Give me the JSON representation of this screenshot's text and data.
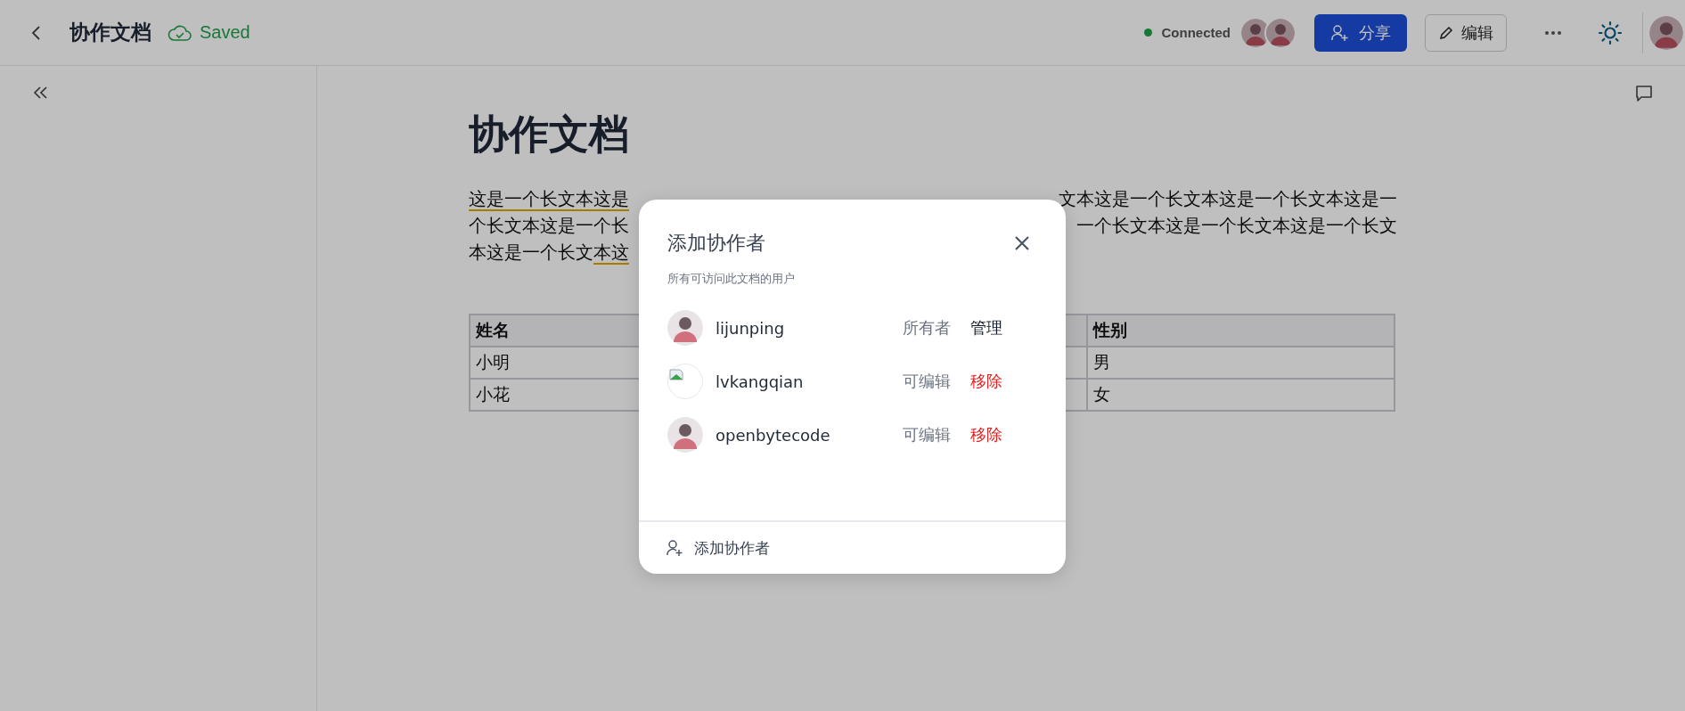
{
  "header": {
    "title": "协作文档",
    "save_status": "Saved",
    "connection": {
      "label": "Connected",
      "connected": true
    },
    "share_button": "分享",
    "edit_button": "编辑"
  },
  "document": {
    "title": "协作文档",
    "lines": [
      {
        "left": [
          {
            "text": "这是一个长文本这是",
            "commented": true
          }
        ],
        "right": [
          {
            "text": "文本这是一个长文本这是一个长文本这是一",
            "commented": false
          }
        ]
      },
      {
        "left": [
          {
            "text": "个长文本这是一个长",
            "commented": false
          }
        ],
        "right": [
          {
            "text": "一个长文本这是一个长文本这是一个长文",
            "commented": false
          }
        ]
      },
      {
        "left": [
          {
            "text": "本这是一个长文",
            "commented": false
          },
          {
            "text": "本这",
            "commented": true
          }
        ]
      }
    ],
    "table": {
      "columns": [
        "姓名",
        "性别"
      ],
      "rows": [
        [
          "小明",
          "男"
        ],
        [
          "小花",
          "女"
        ]
      ]
    }
  },
  "dialog": {
    "title": "添加协作者",
    "subtitle": "所有可访问此文档的用户",
    "members": [
      {
        "name": "lijunping",
        "role": "所有者",
        "action": "管理",
        "removable": false,
        "avatar_broken": false
      },
      {
        "name": "lvkangqian",
        "role": "可编辑",
        "action": "移除",
        "removable": true,
        "avatar_broken": true
      },
      {
        "name": "openbytecode",
        "role": "可编辑",
        "action": "移除",
        "removable": true,
        "avatar_broken": false
      }
    ],
    "footer_button": "添加协作者"
  }
}
